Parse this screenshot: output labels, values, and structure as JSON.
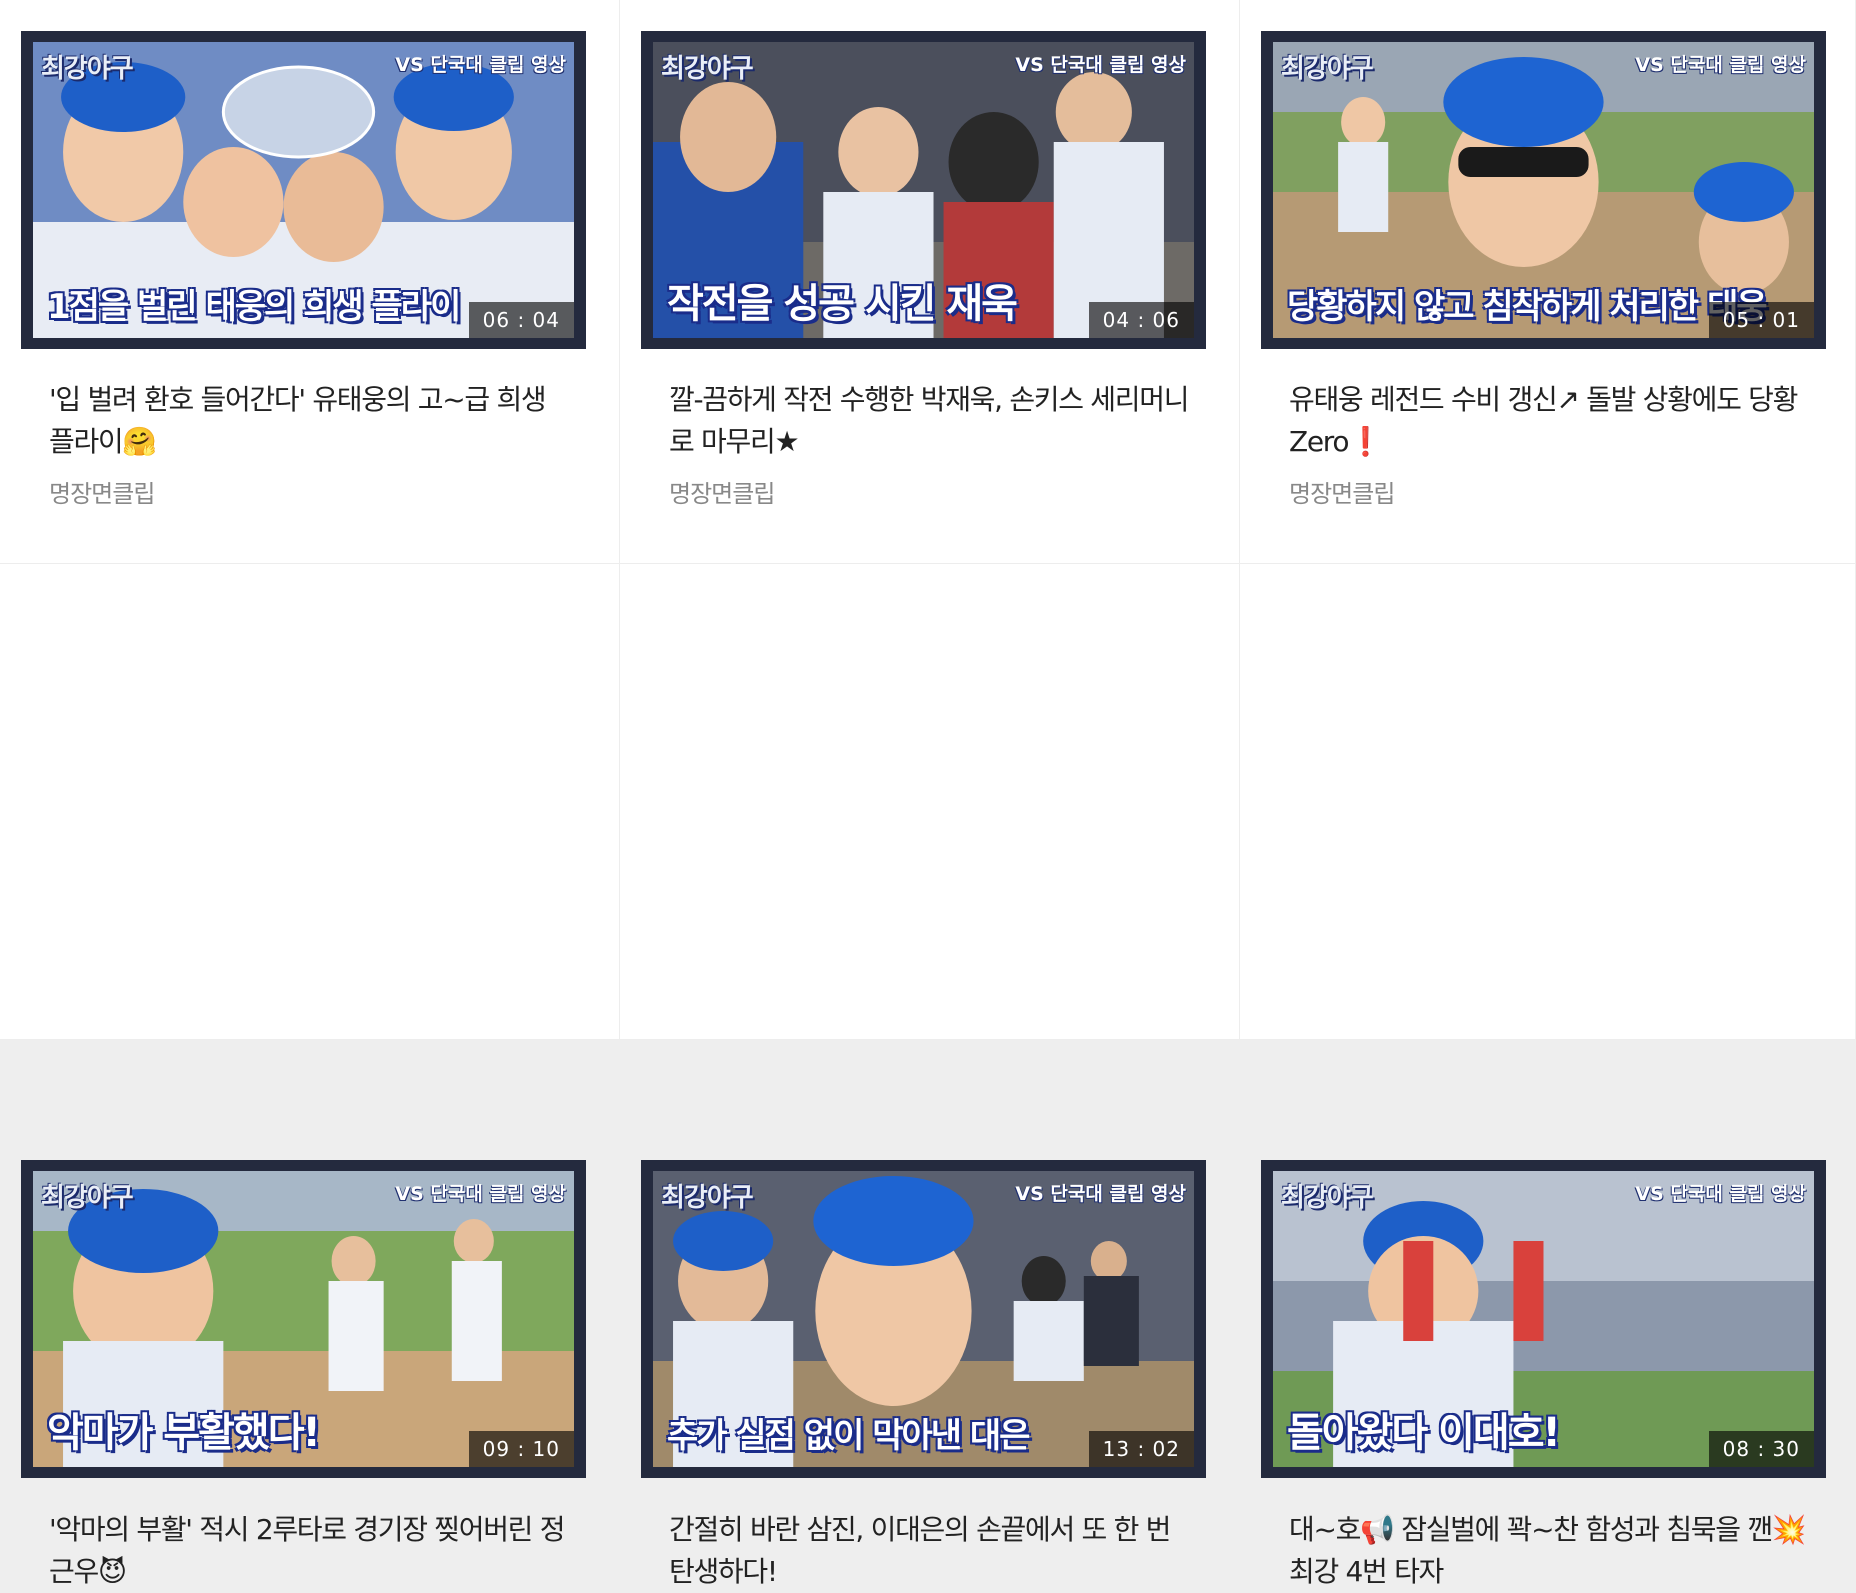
{
  "videos": [
    {
      "brand": "최강야구",
      "tag": "VS 단국대 클립 영상",
      "caption": "1점을 벌린 태웅의 희생 플라이",
      "duration": "06 : 04",
      "title": "'입 벌려 환호 들어간다' 유태웅의 고~급 희생 플라이🤗",
      "category": "명장면클립",
      "bg": "#3c5a9a"
    },
    {
      "brand": "최강야구",
      "tag": "VS 단국대 클립 영상",
      "caption": "작전을 성공 시킨 재욱",
      "duration": "04 : 06",
      "title": "깔-끔하게 작전 수행한 박재욱, 손키스 세리머니로 마무리★",
      "category": "명장면클립",
      "bg": "#4a4f60"
    },
    {
      "brand": "최강야구",
      "tag": "VS 단국대 클립 영상",
      "caption": "당황하지 않고 침착하게 처리한 태웅",
      "duration": "05 : 01",
      "title": "유태웅 레전드 수비 갱신↗ 돌발 상황에도 당황 Zero❗",
      "category": "명장면클립",
      "bg": "#5e8a4a"
    },
    {
      "brand": "최강야구",
      "tag": "VS 단국대 클립 영상",
      "caption": "악마가 부활했다!",
      "duration": "09 : 10",
      "title": "'악마의 부활' 적시 2루타로 경기장 찢어버린 정근우😈",
      "category": "",
      "bg": "#6d9a52"
    },
    {
      "brand": "최강야구",
      "tag": "VS 단국대 클립 영상",
      "caption": "추가 실점 없이 막아낸 대은",
      "duration": "13 : 02",
      "title": "간절히 바란 삼진, 이대은의 손끝에서 또 한 번 탄생하다!",
      "category": "",
      "bg": "#4e5566"
    },
    {
      "brand": "최강야구",
      "tag": "VS 단국대 클립 영상",
      "caption": "돌아왔다 이대호!",
      "duration": "08 : 30",
      "title": "대~호📢 잠실벌에 꽉~찬 함성과 침묵을 깬💥 최강 4번 타자",
      "category": "",
      "bg": "#7a9a66"
    }
  ]
}
